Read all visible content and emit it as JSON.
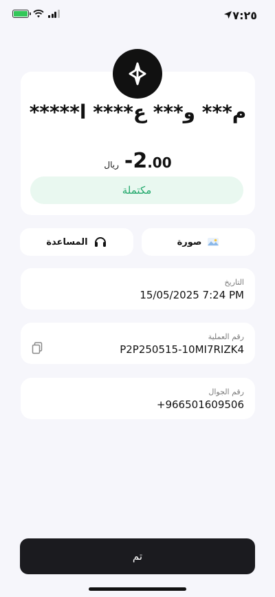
{
  "status_bar": {
    "time": "٧:٢٥"
  },
  "transaction": {
    "recipient_name": "م*** و*** ع**** ا*****",
    "amount_main": "-2",
    "amount_decimal": ".00",
    "currency": "ريال",
    "status": "مكتملة"
  },
  "actions": {
    "photo_label": "صورة",
    "help_label": "المساعدة"
  },
  "details": {
    "date_label": "التاريخ",
    "date_value": "15/05/2025 7:24 PM",
    "txn_label": "رقم العملية",
    "txn_value": "P2P250515-10MI7RIZK4",
    "phone_label": "رقم الجوال",
    "phone_value": "+966501609506"
  },
  "footer": {
    "done_label": "تم"
  },
  "colors": {
    "accent_green": "#1fa76a",
    "pill_bg": "#e9f8f0",
    "button_dark": "#1b1b1f"
  }
}
